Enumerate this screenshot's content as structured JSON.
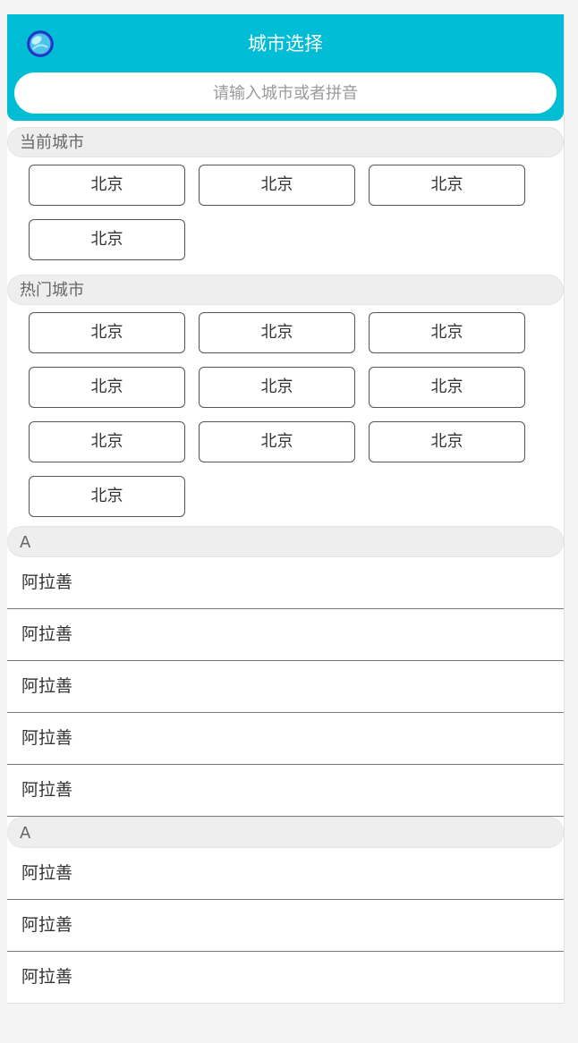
{
  "header": {
    "title": "城市选择",
    "back_icon": "globe-back-icon"
  },
  "search": {
    "placeholder": "请输入城市或者拼音",
    "value": ""
  },
  "current_city": {
    "heading": "当前城市",
    "items": [
      "北京",
      "北京",
      "北京",
      "北京"
    ]
  },
  "hot_cities": {
    "heading": "热门城市",
    "items": [
      "北京",
      "北京",
      "北京",
      "北京",
      "北京",
      "北京",
      "北京",
      "北京",
      "北京",
      "北京"
    ]
  },
  "groups": [
    {
      "letter": "A",
      "items": [
        "阿拉善",
        "阿拉善",
        "阿拉善",
        "阿拉善",
        "阿拉善"
      ]
    },
    {
      "letter": "A",
      "items": [
        "阿拉善",
        "阿拉善",
        "阿拉善"
      ]
    }
  ],
  "colors": {
    "accent": "#00bcd4",
    "section_bg": "#eeeeee"
  }
}
